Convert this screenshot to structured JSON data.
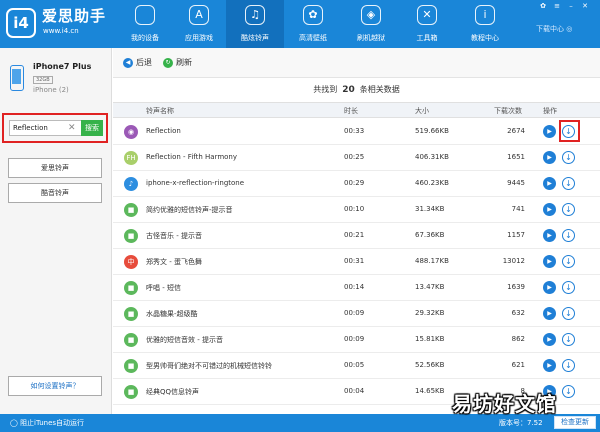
{
  "app": {
    "name": "爱思助手",
    "url": "www.i4.cn",
    "download_center": "下载中心"
  },
  "nav": [
    {
      "label": "我的设备",
      "icon": "apple-icon"
    },
    {
      "label": "应用游戏",
      "icon": "app-store-icon"
    },
    {
      "label": "酷炫铃声",
      "icon": "bell-icon"
    },
    {
      "label": "高清壁纸",
      "icon": "wallpaper-icon"
    },
    {
      "label": "刷机越狱",
      "icon": "box-icon"
    },
    {
      "label": "工具箱",
      "icon": "tools-icon"
    },
    {
      "label": "教程中心",
      "icon": "info-icon"
    }
  ],
  "active_nav": "酷炫铃声",
  "device": {
    "name": "iPhone7 Plus",
    "capacity": "32GB",
    "ios": "iPhone (2)"
  },
  "search": {
    "value": "Reflection",
    "button": "搜索"
  },
  "sidebar": {
    "btn1": "爱思铃声",
    "btn2": "酷音铃声",
    "help": "如何设置铃声？"
  },
  "toolbar": {
    "back": "后退",
    "refresh": "刷新"
  },
  "summary": {
    "prefix": "共找到",
    "count": "20",
    "suffix": "条相关数据"
  },
  "columns": {
    "name": "铃声名称",
    "time": "时长",
    "size": "大小",
    "downloads": "下载次数",
    "ops": "操作"
  },
  "rows": [
    {
      "name": "Reflection",
      "time": "00:33",
      "size": "519.66KB",
      "downloads": "2674",
      "icon_color": "#9b59b6",
      "glyph": "◉"
    },
    {
      "name": "Reflection - Fifth Harmony",
      "time": "00:25",
      "size": "406.31KB",
      "downloads": "1651",
      "icon_color": "#a9cf6a",
      "glyph": "FH"
    },
    {
      "name": "iphone-x-reflection-ringtone",
      "time": "00:29",
      "size": "460.23KB",
      "downloads": "9445",
      "icon_color": "#2d8ee0",
      "glyph": "♪"
    },
    {
      "name": "简约优雅的短信铃声-提示音",
      "time": "00:10",
      "size": "31.34KB",
      "downloads": "741",
      "icon_color": "#5cb85c",
      "glyph": "■"
    },
    {
      "name": "古怪音乐 - 提示音",
      "time": "00:21",
      "size": "67.36KB",
      "downloads": "1157",
      "icon_color": "#5cb85c",
      "glyph": "■"
    },
    {
      "name": "郑秀文 - 蛋飞色舞",
      "time": "00:31",
      "size": "488.17KB",
      "downloads": "13012",
      "icon_color": "#e74c3c",
      "glyph": "中"
    },
    {
      "name": "呼唱 - 短信",
      "time": "00:14",
      "size": "13.47KB",
      "downloads": "1639",
      "icon_color": "#5cb85c",
      "glyph": "■"
    },
    {
      "name": "水晶糖果-超级酷",
      "time": "00:09",
      "size": "29.32KB",
      "downloads": "632",
      "icon_color": "#5cb85c",
      "glyph": "■"
    },
    {
      "name": "优雅的短信音效 - 提示音",
      "time": "00:09",
      "size": "15.81KB",
      "downloads": "862",
      "icon_color": "#5cb85c",
      "glyph": "■"
    },
    {
      "name": "型男帅哥们绝对不可错过的机械短信铃铃",
      "time": "00:05",
      "size": "52.56KB",
      "downloads": "621",
      "icon_color": "#5cb85c",
      "glyph": "■"
    },
    {
      "name": "经典QQ信息铃声",
      "time": "00:04",
      "size": "14.65KB",
      "downloads": "8",
      "icon_color": "#5cb85c",
      "glyph": "■"
    }
  ],
  "statusbar": {
    "itunes": "阻止iTunes自动运行",
    "version_label": "版本号：7.52",
    "update": "检查更新"
  },
  "watermark": "易坊好文馆"
}
